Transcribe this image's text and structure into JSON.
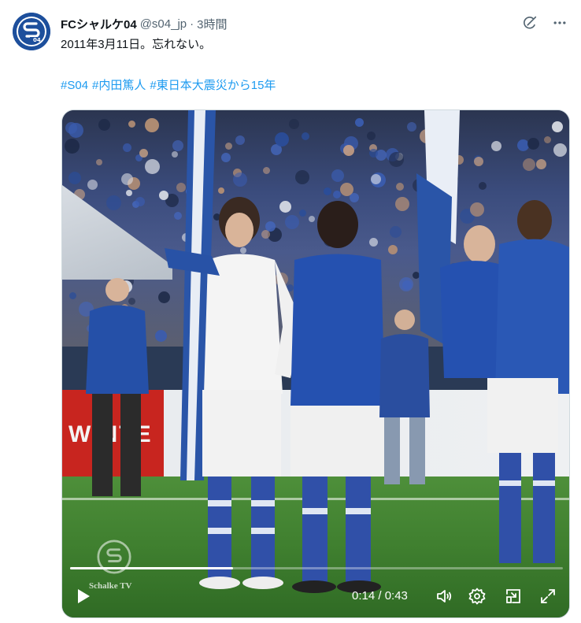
{
  "post": {
    "display_name": "FCシャルケ04",
    "handle": "@s04_jp",
    "separator": "·",
    "time": "3時間",
    "text": "2011年3月11日。忘れない。",
    "hashtags": [
      "#S04",
      "#内田篤人",
      "#東日本大震災から15年"
    ]
  },
  "icons": {
    "grok": "grok-icon",
    "more": "more-icon",
    "play": "play-icon",
    "volume": "volume-icon",
    "settings": "gear-icon",
    "pip": "picture-in-picture-icon",
    "fullscreen": "fullscreen-icon"
  },
  "video": {
    "current_time": "0:14",
    "duration": "0:43",
    "time_readout": "0:14 / 0:43",
    "progress": 0.33,
    "ad_text": "WINTE",
    "watermark_text": "Schalke TV"
  },
  "colors": {
    "link": "#1d9bf0",
    "secondary_text": "#536471",
    "schalke_blue": "#1d4f9c"
  }
}
